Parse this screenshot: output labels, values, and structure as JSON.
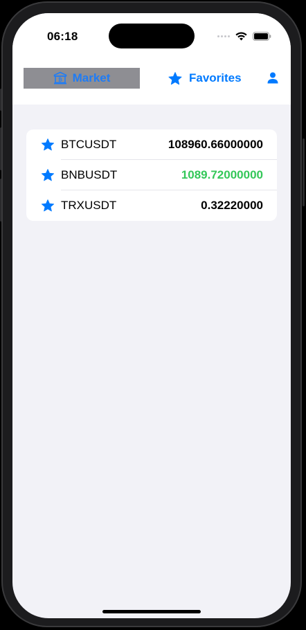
{
  "status_bar": {
    "time": "06:18"
  },
  "nav": {
    "market_label": "Market",
    "favorites_label": "Favorites"
  },
  "colors": {
    "accent": "#007aff",
    "positive": "#34c759",
    "selected_tab_bg": "#8e8e93",
    "background": "#f2f2f7"
  },
  "icons": {
    "market": "bank-building-icon",
    "favorites": "star-icon",
    "profile": "person-icon",
    "row_star": "star-icon"
  },
  "tickers": [
    {
      "symbol": "BTCUSDT",
      "price": "108960.66000000",
      "trend": "neutral"
    },
    {
      "symbol": "BNBUSDT",
      "price": "1089.72000000",
      "trend": "up"
    },
    {
      "symbol": "TRXUSDT",
      "price": "0.32220000",
      "trend": "neutral"
    }
  ]
}
